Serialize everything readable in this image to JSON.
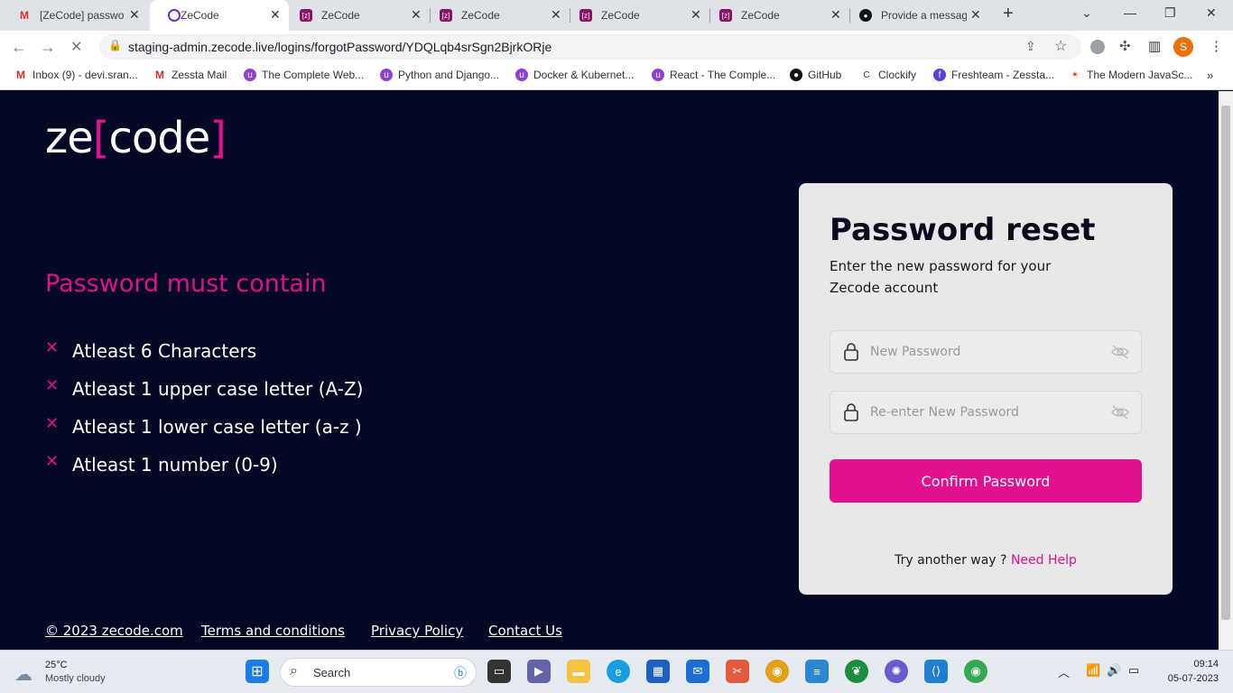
{
  "browser": {
    "tabs": [
      {
        "title": "[ZeCode] passwo",
        "favicon": "gmail-icon"
      },
      {
        "title": "ZeCode",
        "favicon": "zecode-icon",
        "active": true
      },
      {
        "title": "ZeCode",
        "favicon": "zecode-icon"
      },
      {
        "title": "ZeCode",
        "favicon": "zecode-icon"
      },
      {
        "title": "ZeCode",
        "favicon": "zecode-icon"
      },
      {
        "title": "ZeCode",
        "favicon": "zecode-icon"
      },
      {
        "title": "Provide a messag",
        "favicon": "github-icon"
      }
    ],
    "url": "staging-admin.zecode.live/logins/forgotPassword/YDQLqb4srSgn2BjrkORje",
    "profile_initial": "S",
    "bookmarks": [
      "Inbox (9) - devi.sran...",
      "Zessta Mail",
      "The Complete Web...",
      "Python and Django...",
      "Docker & Kubernet...",
      "React - The Comple...",
      "GitHub",
      "Clockify",
      "Freshteam - Zessta...",
      "The Modern JavaSc..."
    ]
  },
  "page": {
    "logo": {
      "ze": "ze",
      "open": "[",
      "code": "code",
      "close": "]"
    },
    "requirements_title": "Password must contain",
    "requirements": [
      "Atleast 6 Characters",
      "Atleast 1 upper case letter (A-Z)",
      "Atleast 1 lower case letter (a-z )",
      "Atleast 1 number (0-9)"
    ],
    "card": {
      "title": "Password reset",
      "subtitle": "Enter the new password for your Zecode account",
      "new_password_placeholder": "New Password",
      "reenter_password_placeholder": "Re-enter New Password",
      "confirm_label": "Confirm Password",
      "help_text": "Try another way ?",
      "help_link": "Need Help"
    },
    "footer": {
      "copyright": "© 2023 zecode.com",
      "terms": "Terms and conditions",
      "privacy": "Privacy Policy",
      "contact": "Contact Us"
    },
    "colors": {
      "accent": "#e0108f",
      "background": "#030824",
      "card": "#e8e8e8"
    }
  },
  "taskbar": {
    "weather_temp": "25°C",
    "weather_desc": "Mostly cloudy",
    "search_label": "Search",
    "time": "09:14",
    "date": "05-07-2023"
  }
}
